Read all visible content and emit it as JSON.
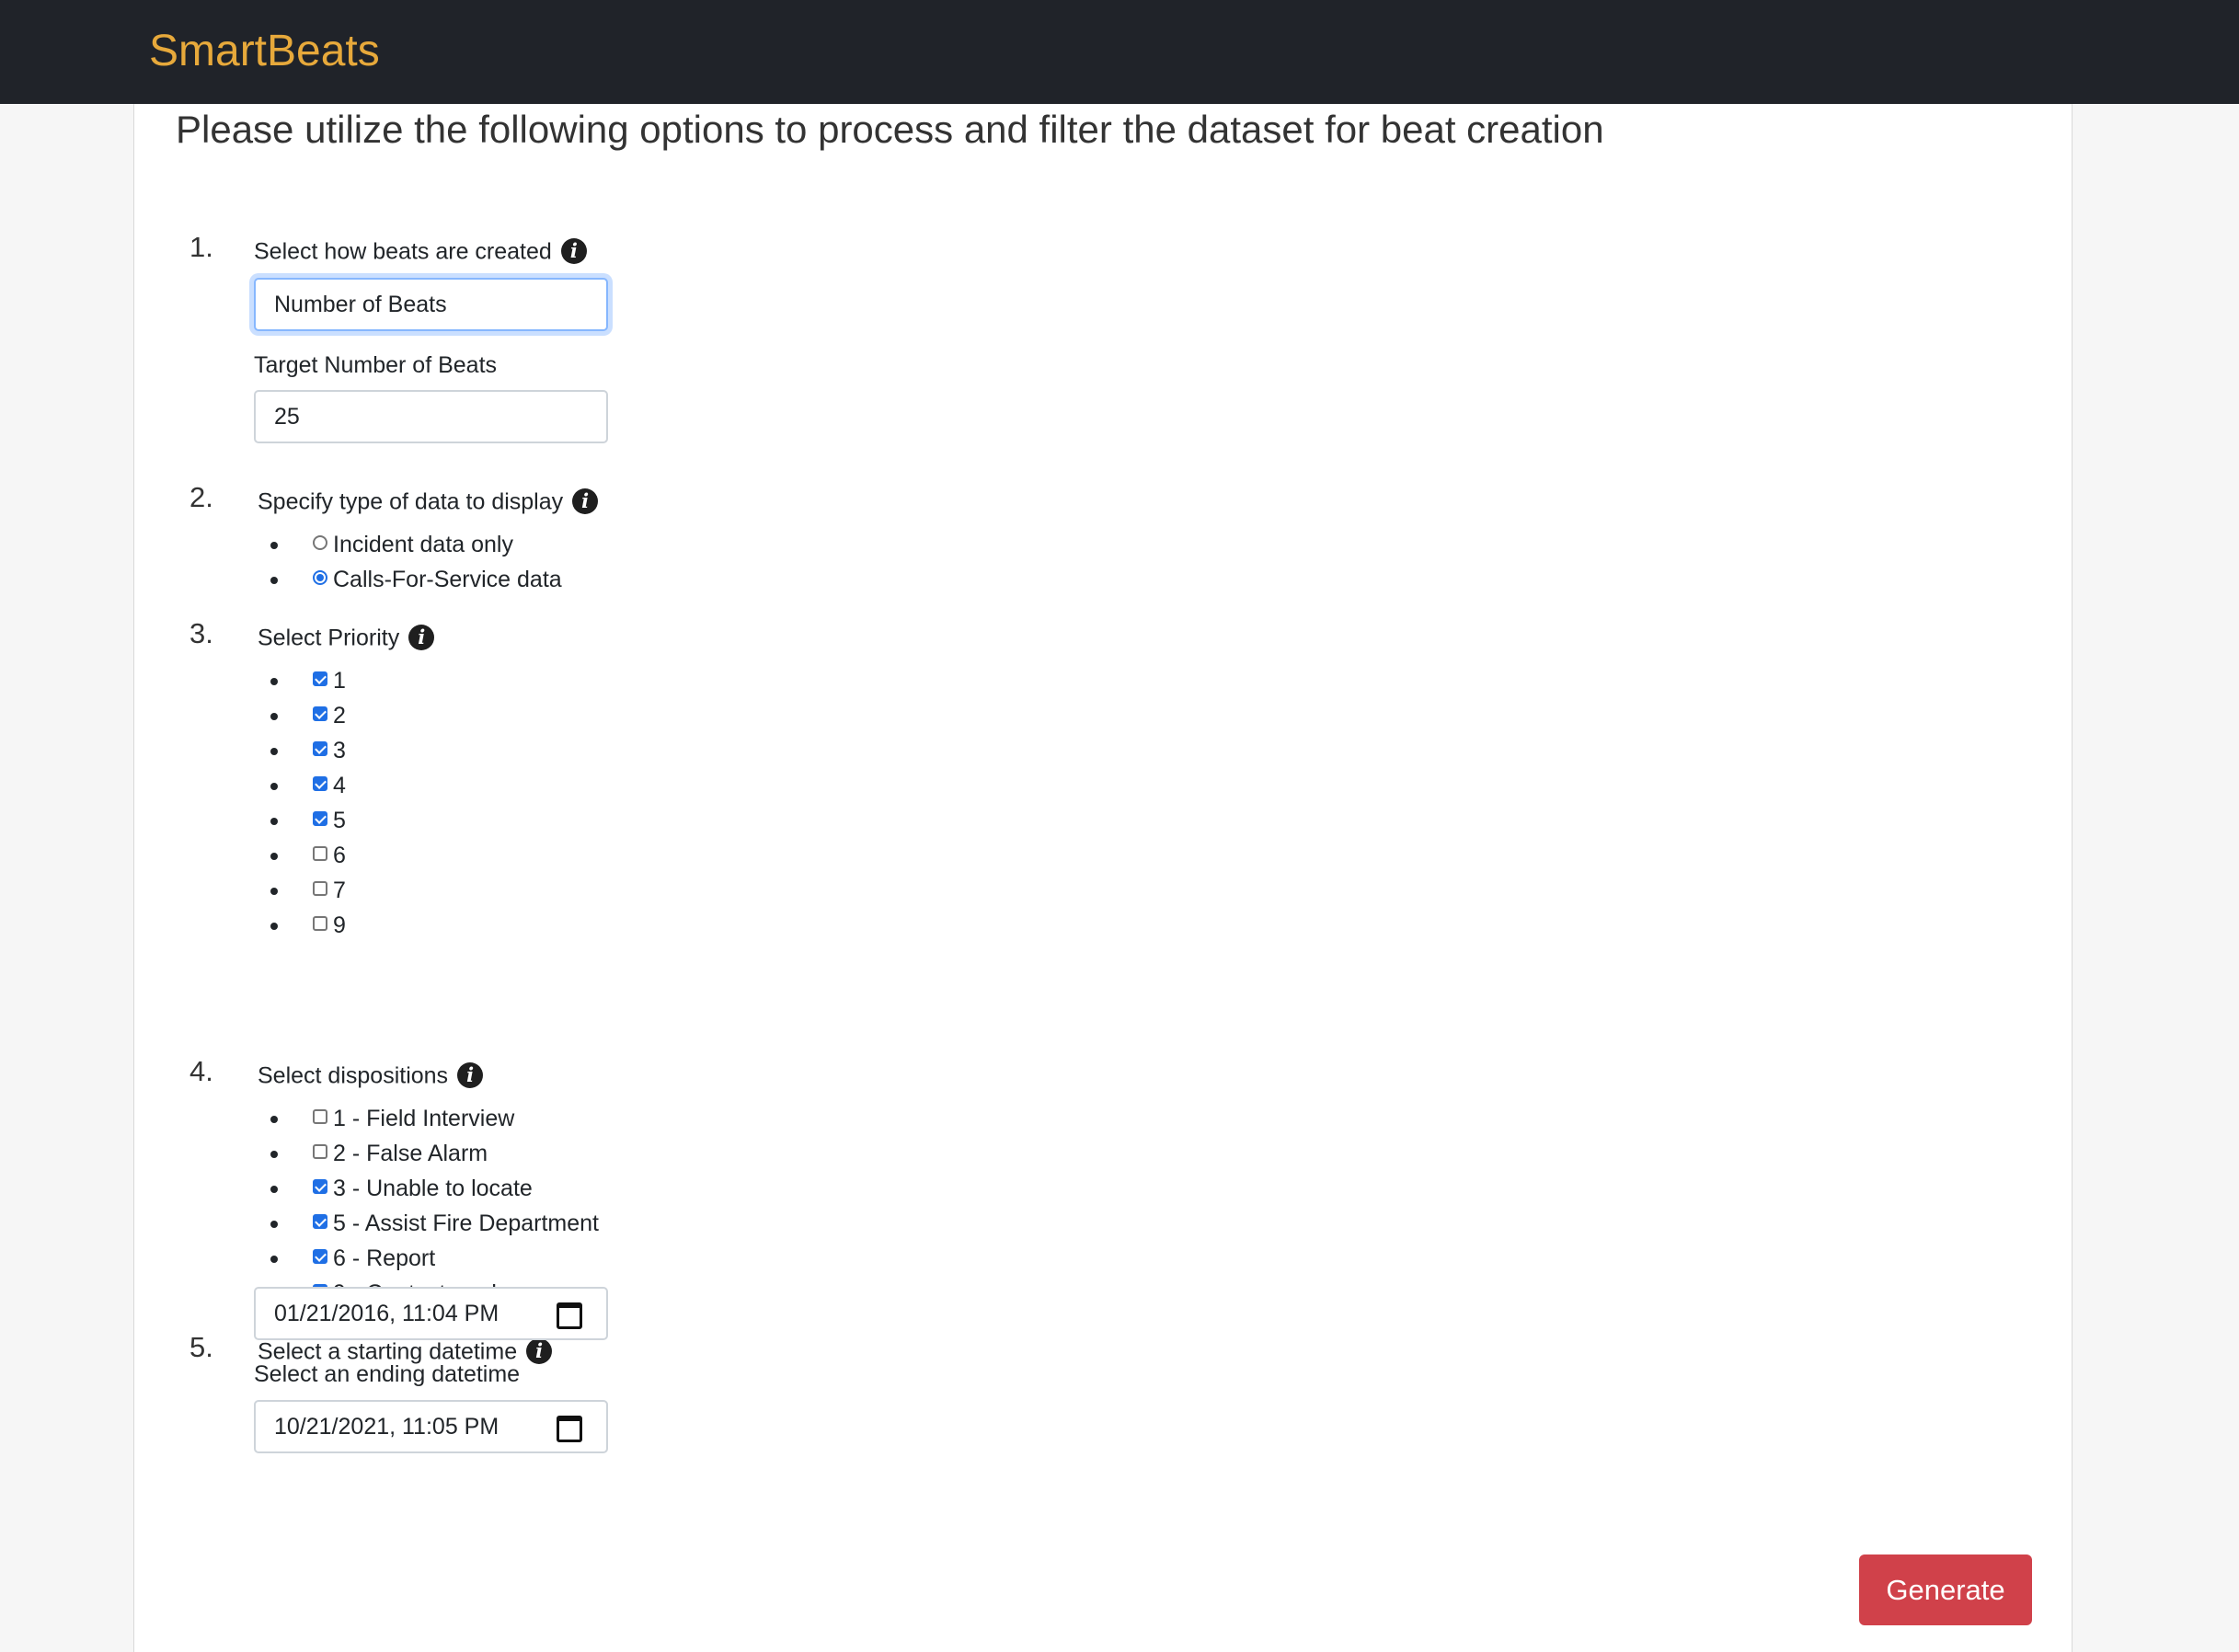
{
  "navbar": {
    "brand": "SmartBeats"
  },
  "page": {
    "heading": "Please utilize the following options to process and filter the dataset for beat creation"
  },
  "steps": {
    "s1": {
      "num": "1.",
      "label": "Select how beats are created",
      "method_value": "Number of Beats",
      "target_label": "Target Number of Beats",
      "target_value": "25"
    },
    "s2": {
      "num": "2.",
      "label": "Specify type of data to display",
      "options": [
        {
          "label": "Incident data only",
          "selected": false
        },
        {
          "label": "Calls-For-Service data",
          "selected": true
        }
      ]
    },
    "s3": {
      "num": "3.",
      "label": "Select Priority",
      "options": [
        {
          "label": "1",
          "checked": true
        },
        {
          "label": "2",
          "checked": true
        },
        {
          "label": "3",
          "checked": true
        },
        {
          "label": "4",
          "checked": true
        },
        {
          "label": "5",
          "checked": true
        },
        {
          "label": "6",
          "checked": false
        },
        {
          "label": "7",
          "checked": false
        },
        {
          "label": "9",
          "checked": false
        }
      ]
    },
    "s4": {
      "num": "4.",
      "label": "Select dispositions",
      "options": [
        {
          "label": "1 - Field Interview",
          "checked": false
        },
        {
          "label": "2 - False Alarm",
          "checked": false
        },
        {
          "label": "3 - Unable to locate",
          "checked": true
        },
        {
          "label": "5 - Assist Fire Department",
          "checked": true
        },
        {
          "label": "6 - Report",
          "checked": true
        },
        {
          "label": "9 - Contact made",
          "checked": true
        }
      ]
    },
    "s5": {
      "num": "5.",
      "label": "Select a starting datetime",
      "start_value": "01/21/2016, 11:04  PM",
      "end_label": "Select an ending datetime",
      "end_value": "10/21/2021, 11:05  PM"
    }
  },
  "actions": {
    "generate_label": "Generate"
  },
  "colors": {
    "navbar_bg": "#202329",
    "brand": "#e7a93b",
    "button_bg": "#d0414a",
    "accent": "#1f6fe5"
  },
  "icons": {
    "info": "info-circle-icon",
    "calendar": "calendar-icon"
  }
}
